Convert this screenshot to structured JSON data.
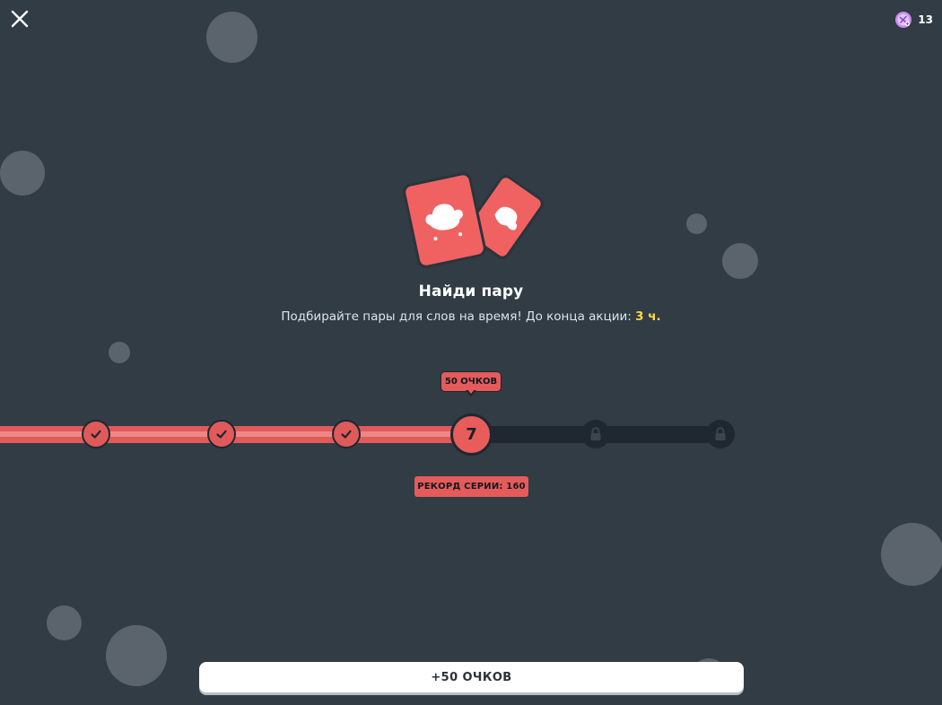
{
  "topbar": {
    "close_icon": "close-icon",
    "gems_icon": "gem-icon",
    "gems_count": "13"
  },
  "hero": {
    "icon": "matching-cards-icon",
    "title": "Найди пару",
    "subtitle_text": "Подбирайте пары для слов на время! До конца акции: ",
    "subtitle_highlight": "3 ч."
  },
  "progress": {
    "points_label": "50 ОЧКОВ",
    "completed_nodes": 3,
    "current_node": "7",
    "locked_nodes": 2,
    "record_label": "РЕКОРД СЕРИИ: 160"
  },
  "cta": {
    "label": "+50 ОЧКОВ"
  },
  "colors": {
    "background": "#313c45",
    "accent": "#e45b5b",
    "highlight": "#ffd84a",
    "track_empty": "#1f2830"
  }
}
